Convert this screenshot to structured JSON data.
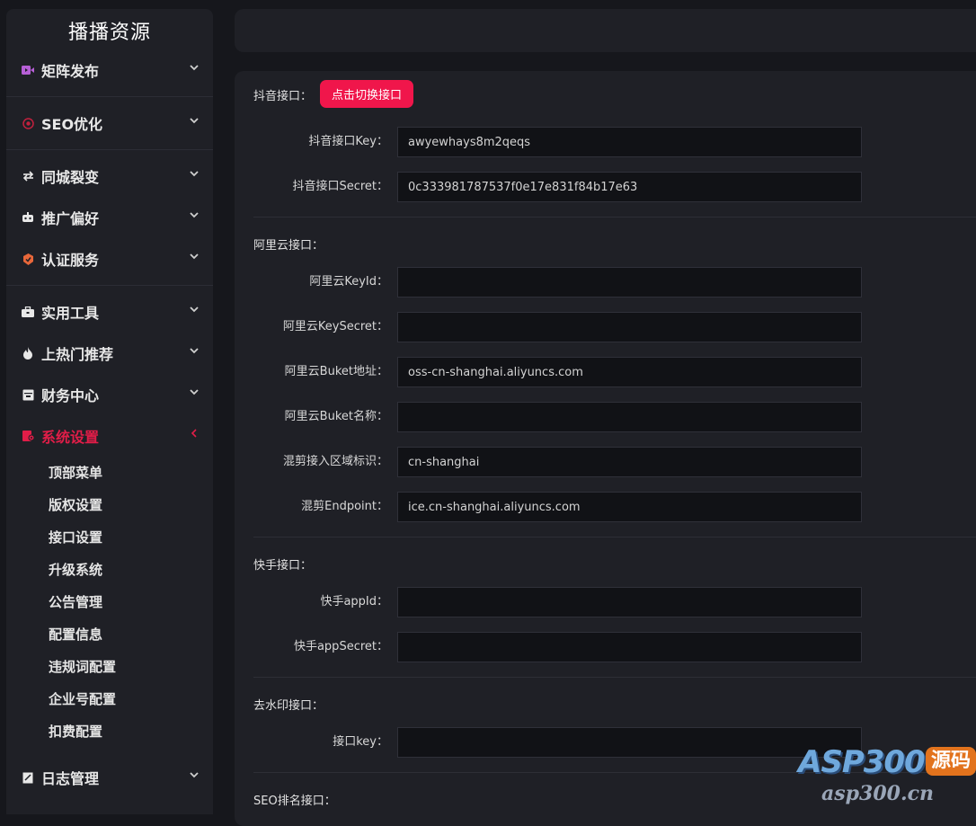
{
  "sidebar": {
    "brand": "播播资源",
    "menu": [
      {
        "label": "矩阵发布",
        "icon": "video-icon"
      },
      {
        "label": "SEO优化",
        "icon": "target-icon"
      },
      {
        "label": "同城裂变",
        "icon": "swap-arrows-icon"
      },
      {
        "label": "推广偏好",
        "icon": "robot-icon"
      },
      {
        "label": "认证服务",
        "icon": "badge-icon"
      },
      {
        "label": "实用工具",
        "icon": "toolbox-icon"
      },
      {
        "label": "上热门推荐",
        "icon": "flame-icon"
      },
      {
        "label": "财务中心",
        "icon": "archive-icon"
      },
      {
        "label": "系统设置",
        "icon": "settings-icon",
        "active": true
      },
      {
        "label": "日志管理",
        "icon": "log-icon"
      }
    ],
    "submenu": [
      "顶部菜单",
      "版权设置",
      "接口设置",
      "升级系统",
      "公告管理",
      "配置信息",
      "违规词配置",
      "企业号配置",
      "扣费配置"
    ]
  },
  "colors": {
    "accent": "#f0164b",
    "active_menu": "#e11d48",
    "bg": "#16171c",
    "panel": "#1f2026"
  },
  "form": {
    "douyin": {
      "title": "抖音接口：",
      "switch_button": "点击切换接口",
      "key_label": "抖音接口Key：",
      "key_value": "awyewhays8m2qeqs",
      "secret_label": "抖音接口Secret：",
      "secret_value": "0c333981787537f0e17e831f84b17e63"
    },
    "aliyun": {
      "title": "阿里云接口：",
      "keyid_label": "阿里云KeyId：",
      "keyid_value": "",
      "keysecret_label": "阿里云KeySecret：",
      "keysecret_value": "",
      "bucket_addr_label": "阿里云Buket地址：",
      "bucket_addr_value": "oss-cn-shanghai.aliyuncs.com",
      "bucket_name_label": "阿里云Buket名称：",
      "bucket_name_value": "",
      "region_label": "混剪接入区域标识：",
      "region_value": "cn-shanghai",
      "endpoint_label": "混剪Endpoint：",
      "endpoint_value": "ice.cn-shanghai.aliyuncs.com"
    },
    "kuaishou": {
      "title": "快手接口：",
      "appid_label": "快手appId：",
      "appid_value": "",
      "appsecret_label": "快手appSecret：",
      "appsecret_value": ""
    },
    "watermark": {
      "title": "去水印接口：",
      "key_label": "接口key：",
      "key_value": ""
    },
    "seo": {
      "title": "SEO排名接口："
    }
  },
  "watermark_logo": {
    "main": "ASP300",
    "tag": "源码",
    "sub": "asp300.cn"
  }
}
